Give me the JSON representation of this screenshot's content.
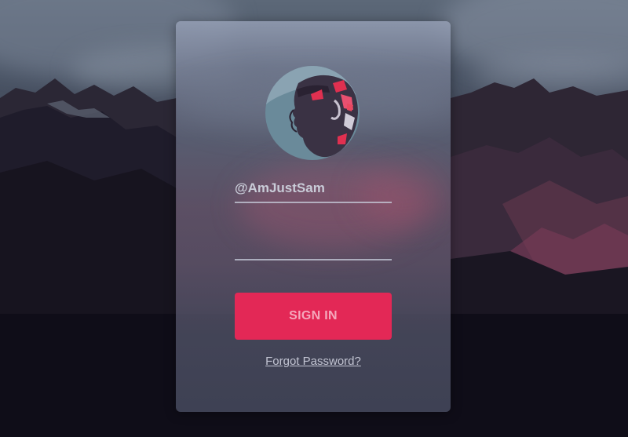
{
  "login": {
    "username_value": "@AmJustSam",
    "password_value": "",
    "signin_label": "SIGN IN",
    "forgot_label": "Forgot Password?"
  },
  "colors": {
    "accent": "#e32856",
    "card_tint": "#7c8296",
    "background_dark": "#0d0c17"
  },
  "icons": {
    "avatar": "bearded-man-portrait"
  }
}
